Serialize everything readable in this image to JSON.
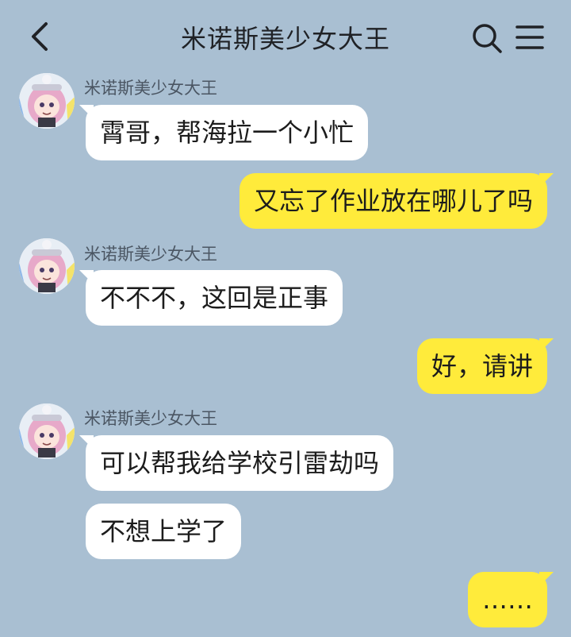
{
  "header": {
    "title": "米诺斯美少女大王",
    "back_icon": "chevron-left-icon",
    "search_icon": "search-icon",
    "menu_icon": "hamburger-menu-icon"
  },
  "colors": {
    "background": "#a9bfd2",
    "incoming_bubble": "#ffffff",
    "outgoing_bubble": "#ffeb3b"
  },
  "messages": [
    {
      "direction": "incoming",
      "sender": "米诺斯美少女大王",
      "text": "霄哥，帮海拉一个小忙"
    },
    {
      "direction": "outgoing",
      "text": "又忘了作业放在哪儿了吗"
    },
    {
      "direction": "incoming",
      "sender": "米诺斯美少女大王",
      "text": "不不不，这回是正事"
    },
    {
      "direction": "outgoing",
      "text": "好，请讲"
    },
    {
      "direction": "incoming",
      "sender": "米诺斯美少女大王",
      "text": "可以帮我给学校引雷劫吗"
    },
    {
      "direction": "incoming",
      "text": "不想上学了"
    },
    {
      "direction": "outgoing",
      "text": "……"
    }
  ]
}
